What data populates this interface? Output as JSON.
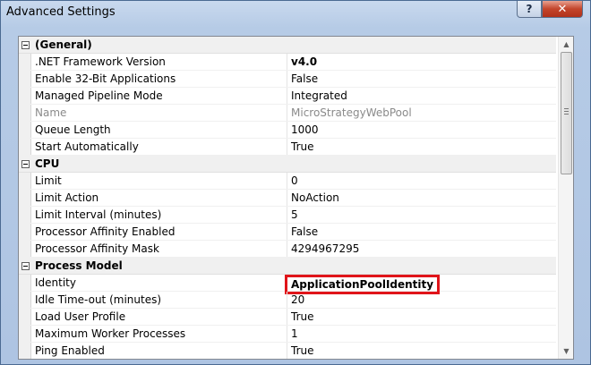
{
  "window": {
    "title": "Advanced Settings",
    "help_label": "?",
    "close_label": "✕"
  },
  "categories": [
    {
      "label": "(General)",
      "properties": [
        {
          "name": ".NET Framework Version",
          "value": "v4.0",
          "bold": true
        },
        {
          "name": "Enable 32-Bit Applications",
          "value": "False"
        },
        {
          "name": "Managed Pipeline Mode",
          "value": "Integrated"
        },
        {
          "name": "Name",
          "value": "MicroStrategyWebPool",
          "disabled": true
        },
        {
          "name": "Queue Length",
          "value": "1000"
        },
        {
          "name": "Start Automatically",
          "value": "True"
        }
      ]
    },
    {
      "label": "CPU",
      "properties": [
        {
          "name": "Limit",
          "value": "0"
        },
        {
          "name": "Limit Action",
          "value": "NoAction"
        },
        {
          "name": "Limit Interval (minutes)",
          "value": "5"
        },
        {
          "name": "Processor Affinity Enabled",
          "value": "False"
        },
        {
          "name": "Processor Affinity Mask",
          "value": "4294967295"
        }
      ]
    },
    {
      "label": "Process Model",
      "properties": [
        {
          "name": "Identity",
          "value": "ApplicationPoolIdentity",
          "highlighted": true
        },
        {
          "name": "Idle Time-out (minutes)",
          "value": "20"
        },
        {
          "name": "Load User Profile",
          "value": "True"
        },
        {
          "name": "Maximum Worker Processes",
          "value": "1"
        },
        {
          "name": "Ping Enabled",
          "value": "True"
        }
      ]
    }
  ],
  "colors": {
    "highlight_border": "#e0141a",
    "close_button": "#c3452b"
  }
}
